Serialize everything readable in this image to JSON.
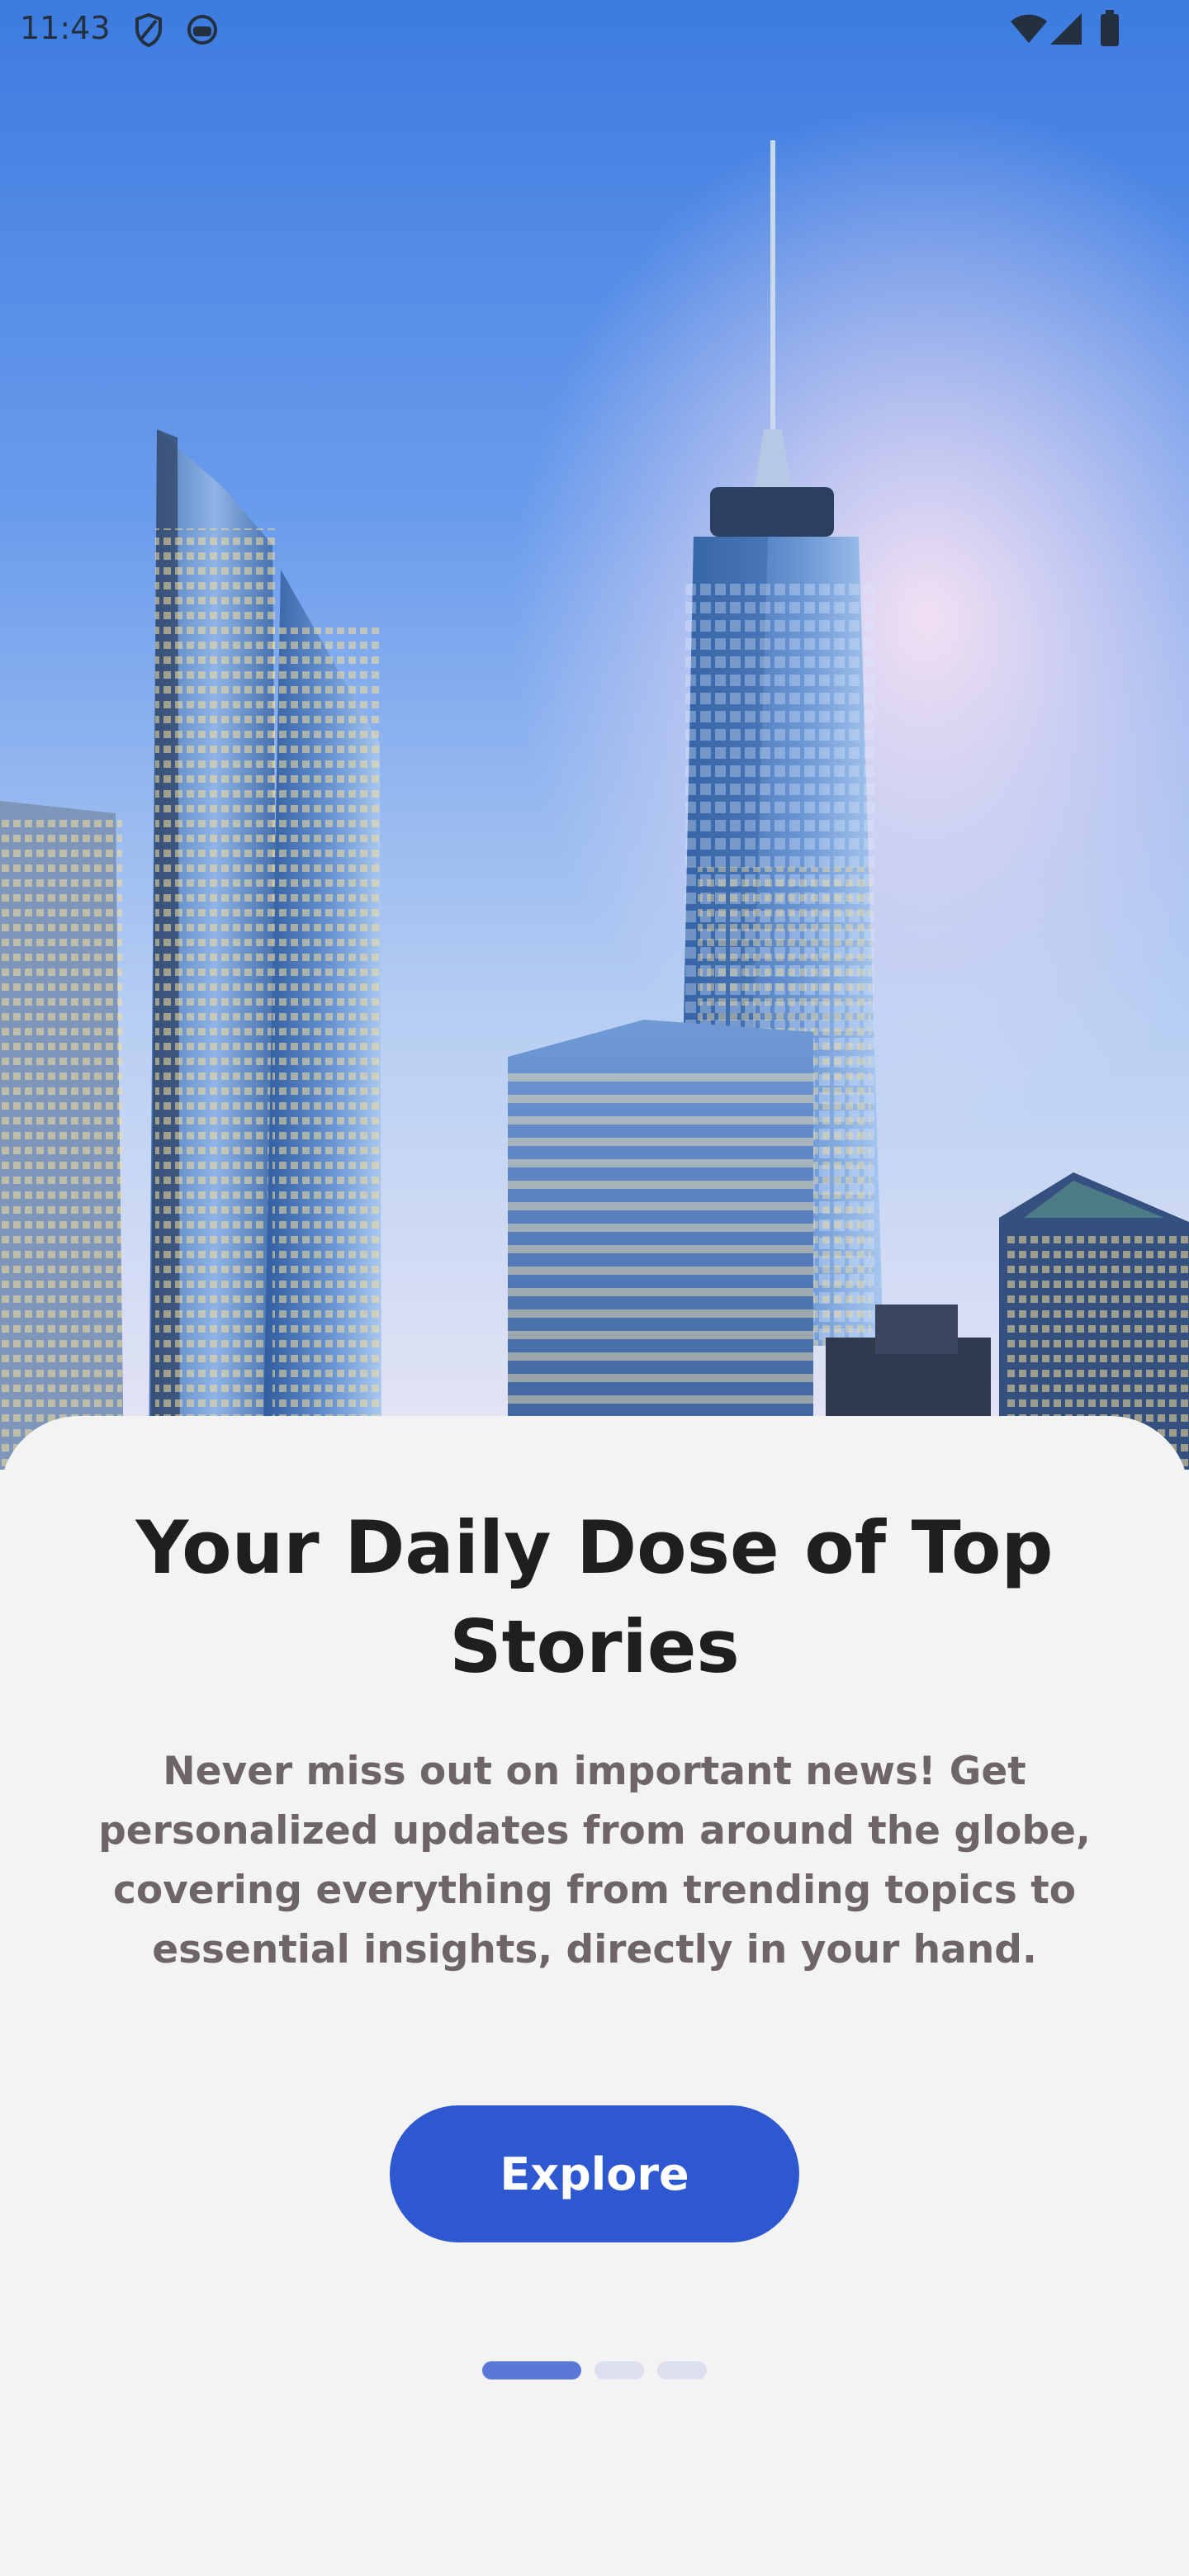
{
  "status_bar": {
    "time": "11:43",
    "icons": [
      "shield-outline-icon",
      "app-robot-icon",
      "wifi-icon",
      "cellular-signal-icon",
      "battery-icon"
    ]
  },
  "hero": {
    "image": "city-skyline-illustration"
  },
  "onboarding": {
    "title": "Your Daily Dose of Top Stories",
    "description": "Never miss out on important news! Get personalized updates from around the globe, covering everything from trending topics to essential insights, directly in your hand.",
    "cta_label": "Explore"
  },
  "pager": {
    "total_pages": 3,
    "active_page": 1
  },
  "colors": {
    "accent": "#2d58cf",
    "active_dot": "#5a78d6",
    "inactive_dot": "#dcdfee",
    "sheet_background": "#f3f3f3",
    "title_text": "#211e1f",
    "body_text": "#6d6567"
  }
}
